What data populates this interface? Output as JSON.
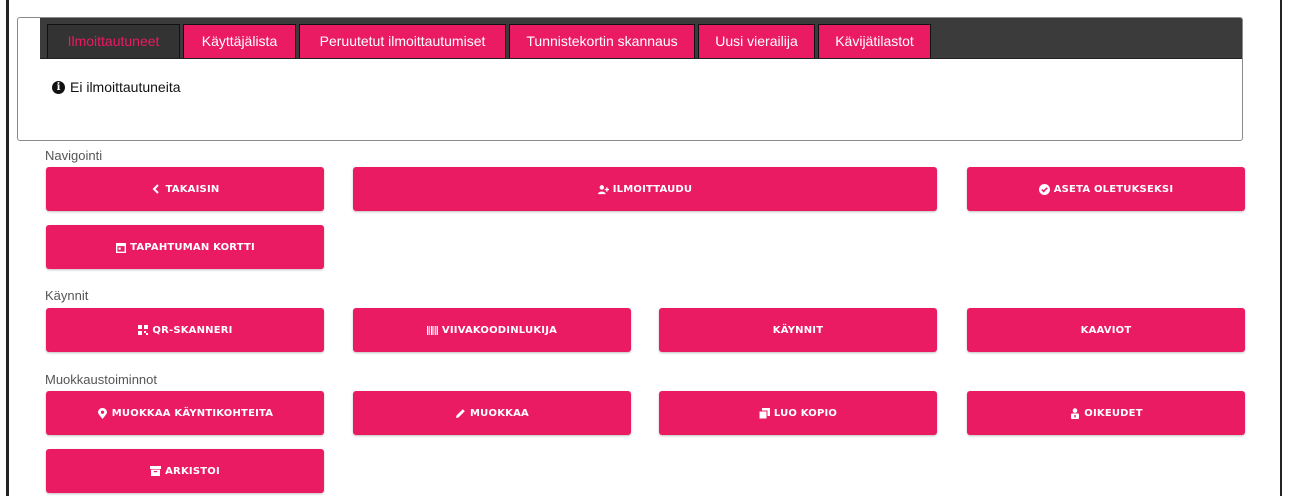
{
  "tabs": [
    {
      "label": "Ilmoittautuneet"
    },
    {
      "label": "Käyttäjälista"
    },
    {
      "label": "Peruutetut ilmoittautumiset"
    },
    {
      "label": "Tunnistekortin skannaus"
    },
    {
      "label": "Uusi vierailija"
    },
    {
      "label": "Kävijätilastot"
    }
  ],
  "alert": {
    "text": "Ei ilmoittautuneita",
    "icon": "info-circle-icon"
  },
  "sections": {
    "navigation": "Navigointi",
    "visits": "Käynnit",
    "editing": "Muokkaustoiminnot"
  },
  "buttons": {
    "back": {
      "label": "TAKAISIN",
      "icon": "chevron-left-icon"
    },
    "register": {
      "label": "ILMOITTAUDU",
      "icon": "user-plus-icon"
    },
    "set_default": {
      "label": "ASETA OLETUKSEKSI",
      "icon": "check-circle-icon"
    },
    "event_card": {
      "label": "TAPAHTUMAN KORTTI",
      "icon": "calendar-icon"
    },
    "qr_scanner": {
      "label": "QR-SKANNERI",
      "icon": "qrcode-icon"
    },
    "barcode_reader": {
      "label": "VIIVAKOODINLUKIJA",
      "icon": "barcode-icon"
    },
    "visits": {
      "label": "KÄYNNIT"
    },
    "charts": {
      "label": "KAAVIOT"
    },
    "edit_visit_targets": {
      "label": "MUOKKAA KÄYNTIKOHTEITA",
      "icon": "map-marker-icon"
    },
    "edit": {
      "label": "MUOKKAA",
      "icon": "pencil-icon"
    },
    "copy": {
      "label": "LUO KOPIO",
      "icon": "copy-icon"
    },
    "permissions": {
      "label": "OIKEUDET",
      "icon": "user-lock-icon"
    },
    "archive": {
      "label": "ARKISTOI",
      "icon": "archive-icon"
    }
  },
  "colors": {
    "accent": "#ea1a63",
    "tabbar": "#3b3b3b"
  }
}
